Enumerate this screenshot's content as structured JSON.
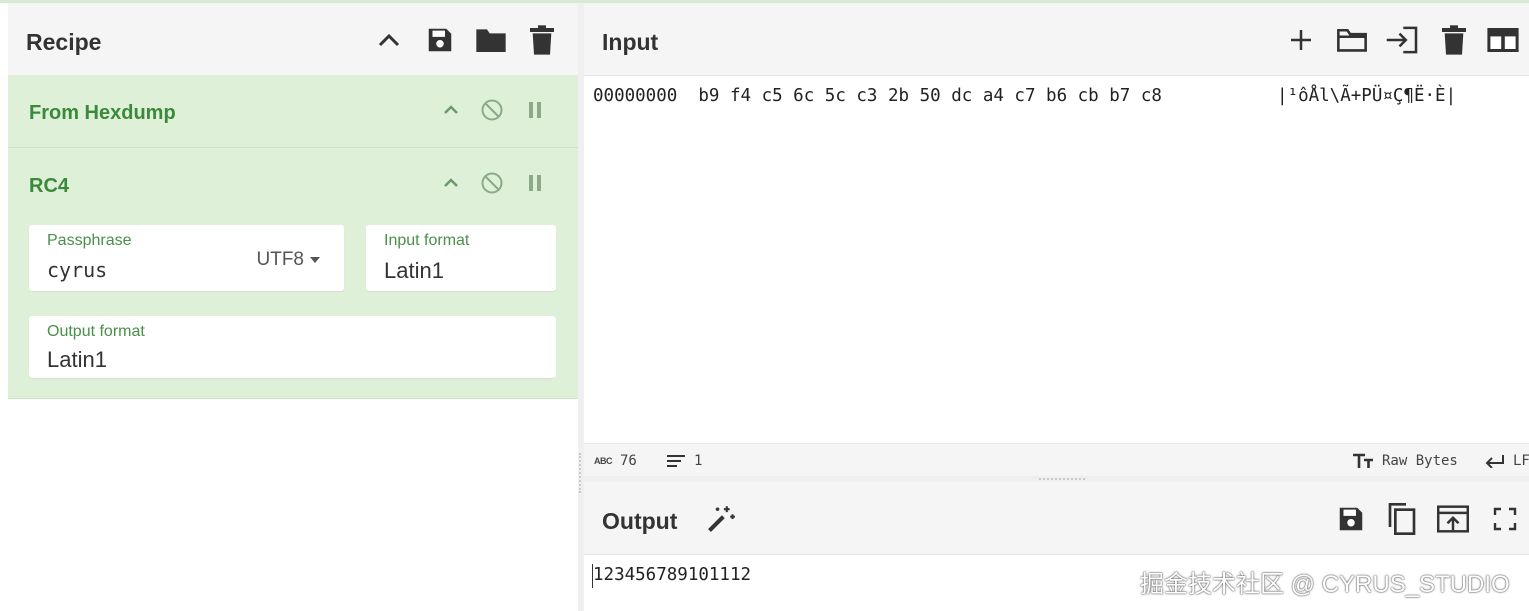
{
  "recipe": {
    "title": "Recipe",
    "icons": [
      "chevron-up-icon",
      "save-icon",
      "folder-icon",
      "trash-icon"
    ],
    "operations": [
      {
        "name": "From Hexdump"
      },
      {
        "name": "RC4",
        "passphrase": {
          "label": "Passphrase",
          "value": "cyrus",
          "encoding": "UTF8"
        },
        "input_format": {
          "label": "Input format",
          "value": "Latin1"
        },
        "output_format": {
          "label": "Output format",
          "value": "Latin1"
        }
      }
    ]
  },
  "input": {
    "title": "Input",
    "icons": [
      "plus-icon",
      "folder-icon",
      "import-icon",
      "trash-icon",
      "layout-icon"
    ],
    "hex_line": "00000000  b9 f4 c5 6c 5c c3 2b 50 dc a4 c7 b6 cb b7 c8",
    "ascii_line": "|¹ôÅl\\Ã+PÜ¤Ç¶Ë·È|",
    "status": {
      "length": "76",
      "lines": "1",
      "encoding": "Raw Bytes",
      "eol": "LF"
    }
  },
  "output": {
    "title": "Output",
    "icons": [
      "magic-wand-icon",
      "save-icon",
      "copy-icon",
      "replace-input-icon",
      "maximize-icon"
    ],
    "text": "123456789101112",
    "watermark": "掘金技术社区 @ CYRUS_STUDIO"
  },
  "colors": {
    "operation_bg": "#dff0d8",
    "operation_title": "#3b8a3b",
    "header_bg": "#f5f5f5"
  }
}
